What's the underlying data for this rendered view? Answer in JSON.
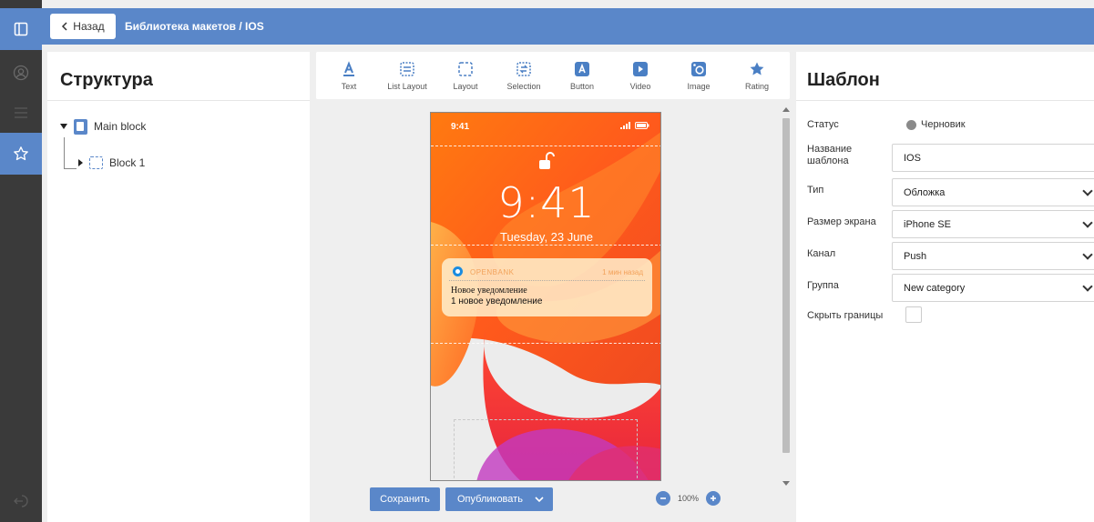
{
  "topbar": {
    "back_label": "Назад",
    "breadcrumb": "Библиотека макетов / IOS"
  },
  "structure": {
    "title": "Структура",
    "tree": [
      {
        "label": "Main block"
      },
      {
        "label": "Block 1"
      }
    ]
  },
  "toolbar": {
    "items": [
      {
        "label": "Text",
        "icon": "text-icon"
      },
      {
        "label": "List Layout",
        "icon": "list-layout-icon"
      },
      {
        "label": "Layout",
        "icon": "layout-icon"
      },
      {
        "label": "Selection",
        "icon": "selection-icon"
      },
      {
        "label": "Button",
        "icon": "button-icon"
      },
      {
        "label": "Video",
        "icon": "video-icon"
      },
      {
        "label": "Image",
        "icon": "image-icon"
      },
      {
        "label": "Rating",
        "icon": "star-icon"
      }
    ]
  },
  "preview": {
    "status_time": "9:41",
    "lock_time": "9:41",
    "date": "Tuesday, 23 June",
    "notification": {
      "app": "OPENBANK",
      "when": "1 мин назад",
      "title": "Новое уведомление",
      "body": "1 новое уведомление"
    }
  },
  "actions": {
    "save_label": "Сохранить",
    "publish_label": "Опубликовать",
    "zoom": "100%"
  },
  "template": {
    "title": "Шаблон",
    "status_label": "Статус",
    "status_value": "Черновик",
    "name_label": "Название шаблона",
    "name_value": "IOS",
    "type_label": "Тип",
    "type_value": "Обложка",
    "screen_label": "Размер экрана",
    "screen_value": "iPhone SE",
    "channel_label": "Канал",
    "channel_value": "Push",
    "group_label": "Группа",
    "group_value": "New category",
    "hide_borders_label": "Скрыть границы"
  },
  "colors": {
    "accent": "#5a87c9",
    "rail": "#3a3a3a"
  }
}
